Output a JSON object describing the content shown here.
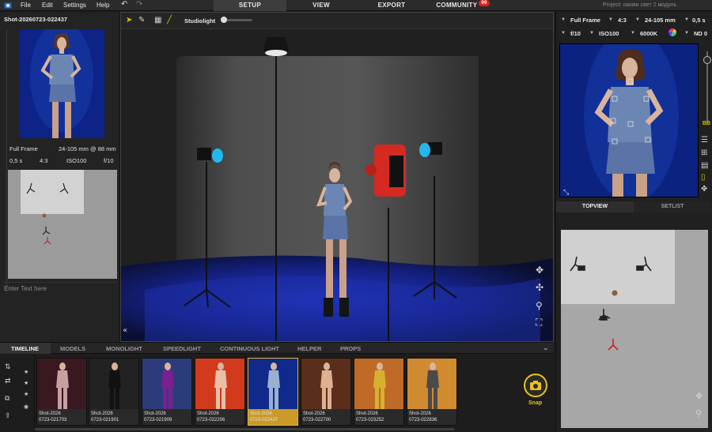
{
  "menubar": {
    "items": [
      "File",
      "Edit",
      "Settings",
      "Help"
    ],
    "tabs": [
      {
        "label": "SETUP",
        "active": true
      },
      {
        "label": "VIEW",
        "active": false
      },
      {
        "label": "EXPORT",
        "active": false
      },
      {
        "label": "COMMUNITY",
        "active": false,
        "badge": "99"
      }
    ],
    "project": "Project: оживи свет 2 модуль"
  },
  "left_panel": {
    "shot_title": "Shot-20260723-022437",
    "sensor": "Full Frame",
    "lens": "24-105 mm @ 88 mm",
    "shutter": "0,5 s",
    "aspect": "4:3",
    "iso": "ISO100",
    "aperture": "f/10",
    "note_placeholder": "Enter Text here"
  },
  "viewport": {
    "studiolight_label": "Studiolight",
    "studiolight_level": 0.0
  },
  "right_panel": {
    "sensor": "Full Frame",
    "aspect": "4:3",
    "lens": "24-105 mm",
    "shutter": "0,5 s",
    "aperture": "f/10",
    "iso": "ISO100",
    "white_balance": "6000K",
    "nd": "ND 0",
    "bb_label": "BB",
    "tabs": [
      {
        "label": "TOPVIEW",
        "active": true
      },
      {
        "label": "SETLIST",
        "active": false
      }
    ]
  },
  "bottom_tabs": [
    "TIMELINE",
    "MODELS",
    "MONOLIGHT",
    "SPEEDLIGHT",
    "CONTINUOUS LIGHT",
    "HELPER",
    "PROPS"
  ],
  "timeline": {
    "shots": [
      {
        "line1": "Shot-2026",
        "line2": "0723-021703",
        "bg": "#3a1820",
        "figure": "#c8a0a0",
        "selected": false
      },
      {
        "line1": "Shot-2026",
        "line2": "0723-021901",
        "bg": "#222222",
        "figure": "#111111",
        "selected": false
      },
      {
        "line1": "Shot-2026",
        "line2": "0723-021909",
        "bg": "#2c3c7a",
        "figure": "#7a2090",
        "selected": false
      },
      {
        "line1": "Shot-2026",
        "line2": "0723-022206",
        "bg": "#d23a1e",
        "figure": "#e8c0a8",
        "selected": false
      },
      {
        "line1": "Shot-2026",
        "line2": "0723-022437",
        "bg": "#0f2a8a",
        "figure": "#9ab0d0",
        "selected": true
      },
      {
        "line1": "Shot-2026",
        "line2": "0723-022700",
        "bg": "#5a2e1a",
        "figure": "#e0b090",
        "selected": false
      },
      {
        "line1": "Shot-2026",
        "line2": "0723-023252",
        "bg": "#c06a28",
        "figure": "#d8b030",
        "selected": false
      },
      {
        "line1": "Shot-2026",
        "line2": "0723-022836",
        "bg": "#d08a30",
        "figure": "#4a4a4a",
        "selected": false
      }
    ],
    "snap_label": "Snap"
  },
  "colors": {
    "accent": "#e8c21c",
    "selection": "#c99a28",
    "community_badge": "#e02020",
    "light_blue_gel": "#22b8ee",
    "scene_blue": "#1a2fa8",
    "camera_red": "#d42a22"
  }
}
